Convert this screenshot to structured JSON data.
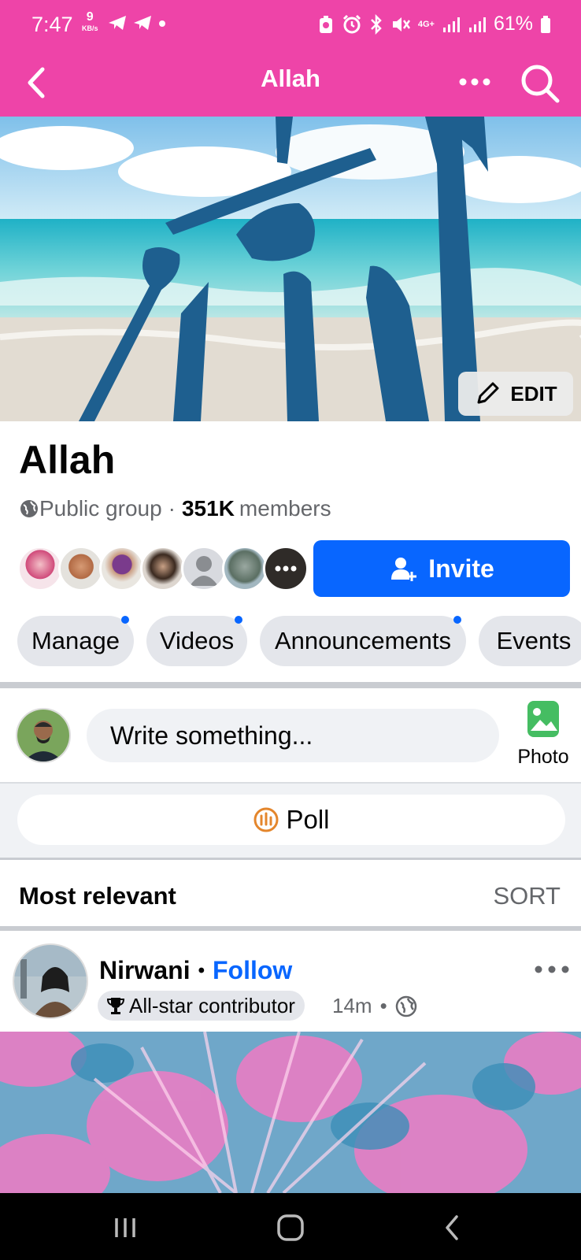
{
  "status_bar": {
    "time": "7:47",
    "net_speed_value": "9",
    "net_speed_unit": "KB/s",
    "network": "4G+",
    "battery": "61%"
  },
  "header": {
    "title": "Allah",
    "back_icon": "chevron-left-icon",
    "more_icon": "more-horizontal-icon",
    "search_icon": "search-icon"
  },
  "cover": {
    "edit_label": "EDIT"
  },
  "group": {
    "name": "Allah",
    "privacy": "Public group",
    "separator": "·",
    "member_count": "351K",
    "member_label": "members",
    "invite_label": "Invite"
  },
  "chips": [
    {
      "label": "Manage",
      "has_dot": true
    },
    {
      "label": "Videos",
      "has_dot": true
    },
    {
      "label": "Announcements",
      "has_dot": true
    },
    {
      "label": "Events",
      "has_dot": false
    }
  ],
  "composer": {
    "placeholder": "Write something...",
    "photo_label": "Photo",
    "poll_label": "Poll"
  },
  "feed": {
    "sort_heading": "Most relevant",
    "sort_label": "SORT"
  },
  "post": {
    "author": "Nirwani",
    "bullet": "•",
    "follow_label": "Follow",
    "badge": "All-star contributor",
    "time": "14m",
    "time_bullet": "•"
  },
  "colors": {
    "header_pink": "#ee44a8",
    "accent_blue": "#0866ff",
    "chip_bg": "#e4e6eb",
    "secondary_text": "#65676b"
  }
}
